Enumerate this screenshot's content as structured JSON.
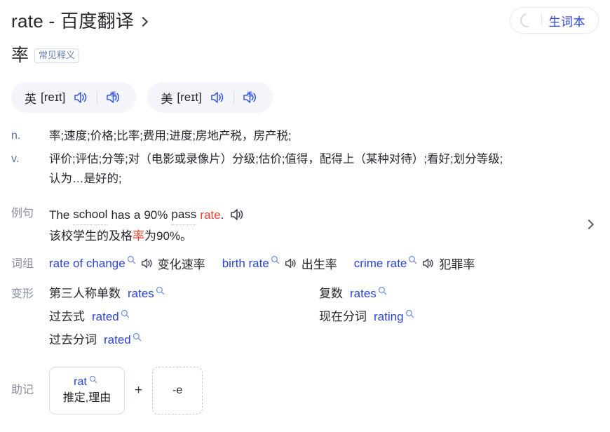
{
  "header": {
    "title": "rate - 百度翻译",
    "title_chevron_icon": "chevron-right-icon",
    "vocab_button": {
      "icon": "loading-circle-icon",
      "label": "生词本"
    }
  },
  "headword": {
    "word": "率",
    "badge": "常见释义"
  },
  "pronunciations": [
    {
      "region": "英",
      "phonetic": "[reɪt]",
      "speaker_icon": "speaker-icon",
      "slow_speaker_icon": "slow-speaker-icon",
      "slow_label": "慢"
    },
    {
      "region": "美",
      "phonetic": "[reɪt]",
      "speaker_icon": "speaker-icon",
      "slow_speaker_icon": "slow-speaker-icon",
      "slow_label": "慢"
    }
  ],
  "definitions": [
    {
      "pos": "n.",
      "text": "率;速度;价格;比率;费用;进度;房地产税，房产税;"
    },
    {
      "pos": "v.",
      "line1": "评价;评估;分等;对（电影或录像片）分级;估价;值得，配得上（某种对待）;看好;划分等级;",
      "line2": "认为…是好的;"
    }
  ],
  "example": {
    "label": "例句",
    "en_parts": {
      "w1": "The",
      "w2": "school",
      "w3": "has",
      "w4": "a",
      "w5": "90%",
      "w6": "pass",
      "w7": "rate",
      "w8": "."
    },
    "speaker_icon": "speaker-icon",
    "zh_before": "该校学生的及格",
    "zh_keyword": "率",
    "zh_after": "为90%。",
    "arrow_icon": "chevron-right-icon"
  },
  "phrases": {
    "label": "词组",
    "items": [
      {
        "en": "rate of change",
        "zh": "变化速率",
        "search_icon": "search-icon",
        "speaker_icon": "speaker-icon"
      },
      {
        "en": "birth rate",
        "zh": "出生率",
        "search_icon": "search-icon",
        "speaker_icon": "speaker-icon"
      },
      {
        "en": "crime rate",
        "zh": "犯罪率",
        "search_icon": "search-icon",
        "speaker_icon": "speaker-icon"
      }
    ]
  },
  "forms": {
    "label": "变形",
    "items": [
      {
        "key": "第三人称单数",
        "value": "rates",
        "search_icon": "search-icon"
      },
      {
        "key": "复数",
        "value": "rates",
        "search_icon": "search-icon"
      },
      {
        "key": "过去式",
        "value": "rated",
        "search_icon": "search-icon"
      },
      {
        "key": "现在分词",
        "value": "rating",
        "search_icon": "search-icon"
      },
      {
        "key": "过去分词",
        "value": "rated",
        "search_icon": "search-icon"
      }
    ]
  },
  "mnemonic": {
    "label": "助记",
    "card1_top": "rat",
    "card1_search_icon": "search-icon",
    "card1_bottom": "推定,理由",
    "plus": "+",
    "card2": "-e"
  },
  "colors": {
    "link_blue": "#2b44d6",
    "keyword_red": "#e8422e",
    "pill_bg": "#f3f5fa",
    "label_grey": "#8a8f9e",
    "pos_blue_grey": "#5b6c99"
  }
}
